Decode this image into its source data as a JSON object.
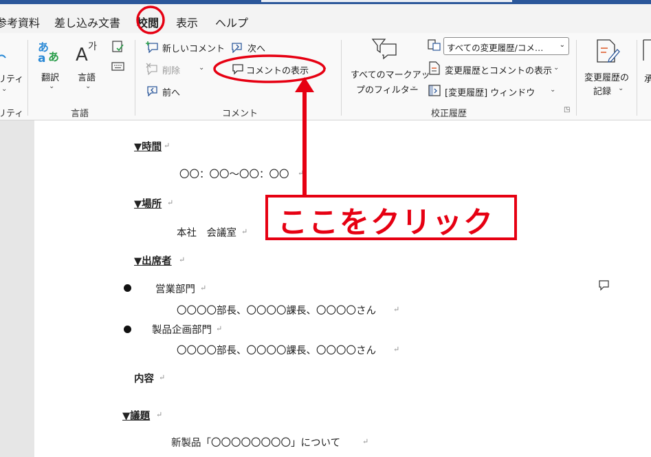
{
  "tabs": [
    {
      "label": "参考資料"
    },
    {
      "label": "差し込み文書"
    },
    {
      "label": "校閲"
    },
    {
      "label": "表示"
    },
    {
      "label": "ヘルプ"
    }
  ],
  "ribbon": {
    "accessibility": {
      "label": "リティ",
      "group": "リティ"
    },
    "language": {
      "translate_label": "翻訳",
      "language_label": "言語",
      "group": "言語"
    },
    "comment": {
      "new_comment": "新しいコメント",
      "next": "次へ",
      "delete": "削除",
      "show_comments": "コメントの表示",
      "previous": "前へ",
      "group": "コメント"
    },
    "tracking": {
      "markup_filter_line1": "すべてのマークアッ",
      "markup_filter_line2": "プのフィルター",
      "dropdown_value": "すべての変更履歴/コメ…",
      "show_changes": "変更履歴とコメントの表示",
      "reviewing_pane": "[変更履歴] ウィンドウ",
      "group": "校正履歴"
    },
    "track_changes": {
      "line1": "変更履歴の",
      "line2": "記録"
    },
    "cut_label": "承"
  },
  "document": {
    "time_heading": "▼時間",
    "time_value": "〇〇：〇〇〜〇〇：〇〇",
    "place_heading": "▼場所",
    "place_value": "本社　会議室",
    "attendees_heading": "▼出席者",
    "dept1": "営業部門",
    "dept1_members": "〇〇〇〇部長、〇〇〇〇課長、〇〇〇〇さん",
    "dept2": "製品企画部門",
    "dept2_members": "〇〇〇〇部長、〇〇〇〇課長、〇〇〇〇さん",
    "content_heading": "内容",
    "agenda_heading": "▼議題",
    "agenda_value": "新製品「〇〇〇〇〇〇〇〇」について",
    "para_mark": "↵"
  },
  "annotation": {
    "callout_text": "ここをクリック",
    "accent_color": "#e60012"
  }
}
